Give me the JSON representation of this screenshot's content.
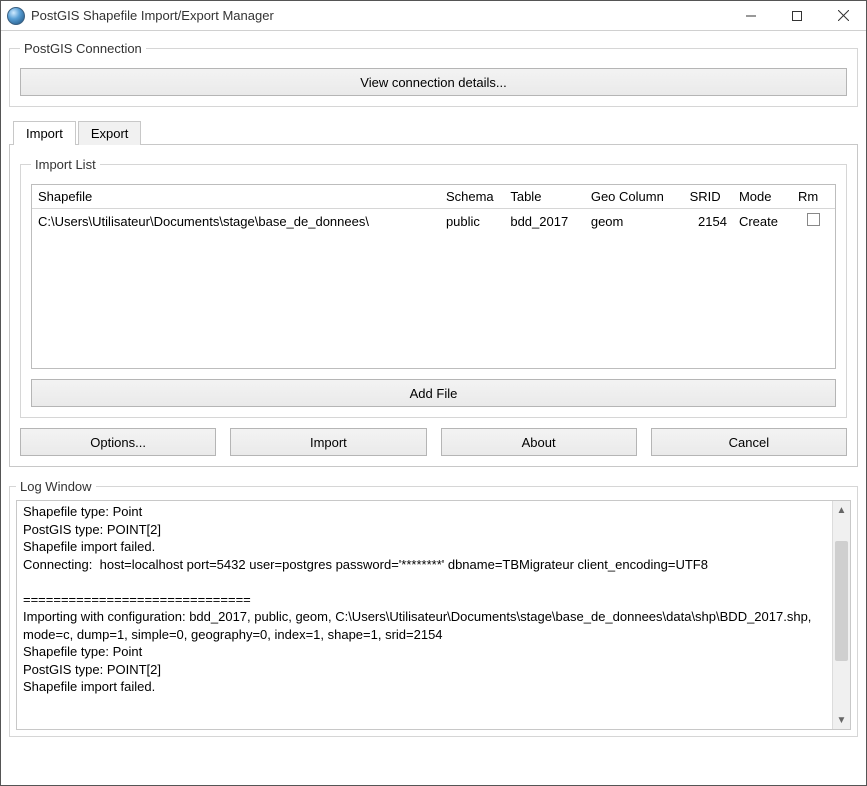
{
  "window": {
    "title": "PostGIS Shapefile Import/Export Manager"
  },
  "connection": {
    "legend": "PostGIS Connection",
    "view_details_label": "View connection details..."
  },
  "tabs": {
    "import": "Import",
    "export": "Export"
  },
  "import_list": {
    "legend": "Import List",
    "columns": {
      "shapefile": "Shapefile",
      "schema": "Schema",
      "table": "Table",
      "geo_column": "Geo Column",
      "srid": "SRID",
      "mode": "Mode",
      "rm": "Rm"
    },
    "rows": [
      {
        "shapefile": "C:\\Users\\Utilisateur\\Documents\\stage\\base_de_donnees\\",
        "schema": "public",
        "table": "bdd_2017",
        "geo_column": "geom",
        "srid": "2154",
        "mode": "Create",
        "rm": false
      }
    ],
    "add_file_label": "Add File"
  },
  "action_buttons": {
    "options": "Options...",
    "import": "Import",
    "about": "About",
    "cancel": "Cancel"
  },
  "log": {
    "legend": "Log Window",
    "text": "Shapefile type: Point\nPostGIS type: POINT[2]\nShapefile import failed.\nConnecting:  host=localhost port=5432 user=postgres password='********' dbname=TBMigrateur client_encoding=UTF8\n\n==============================\nImporting with configuration: bdd_2017, public, geom, C:\\Users\\Utilisateur\\Documents\\stage\\base_de_donnees\\data\\shp\\BDD_2017.shp, mode=c, dump=1, simple=0, geography=0, index=1, shape=1, srid=2154\nShapefile type: Point\nPostGIS type: POINT[2]\nShapefile import failed."
  }
}
